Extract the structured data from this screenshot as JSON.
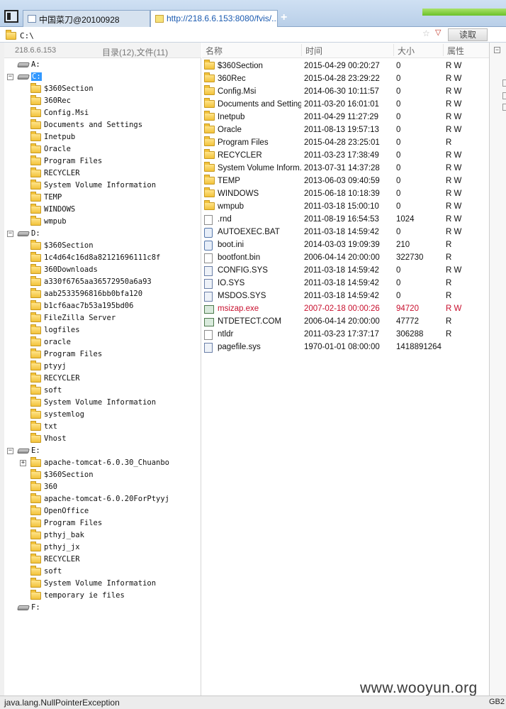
{
  "tabs": [
    {
      "label": "中国菜刀@20100928",
      "active": false
    },
    {
      "label": "http://218.6.6.153:8080/fvis/...",
      "active": true
    }
  ],
  "new_tab_label": "+",
  "address": {
    "value": "C:\\",
    "read_button": "读取"
  },
  "left_header": {
    "ip": "218.6.6.153",
    "counts": "目录(12),文件(11)"
  },
  "tree": [
    {
      "label": "A:",
      "type": "drive",
      "level": 0,
      "expander": ""
    },
    {
      "label": "C:",
      "type": "drive",
      "level": 0,
      "expander": "−",
      "selected": true
    },
    {
      "label": "$360Section",
      "type": "folder",
      "level": 1
    },
    {
      "label": "360Rec",
      "type": "folder",
      "level": 1
    },
    {
      "label": "Config.Msi",
      "type": "folder",
      "level": 1
    },
    {
      "label": "Documents and Settings",
      "type": "folder",
      "level": 1
    },
    {
      "label": "Inetpub",
      "type": "folder",
      "level": 1
    },
    {
      "label": "Oracle",
      "type": "folder",
      "level": 1
    },
    {
      "label": "Program Files",
      "type": "folder",
      "level": 1
    },
    {
      "label": "RECYCLER",
      "type": "folder",
      "level": 1
    },
    {
      "label": "System Volume Information",
      "type": "folder",
      "level": 1
    },
    {
      "label": "TEMP",
      "type": "folder",
      "level": 1
    },
    {
      "label": "WINDOWS",
      "type": "folder",
      "level": 1
    },
    {
      "label": "wmpub",
      "type": "folder",
      "level": 1
    },
    {
      "label": "D:",
      "type": "drive",
      "level": 0,
      "expander": "−"
    },
    {
      "label": "$360Section",
      "type": "folder",
      "level": 1
    },
    {
      "label": "1c4d64c16d8a82121696111c8f",
      "type": "folder",
      "level": 1
    },
    {
      "label": "360Downloads",
      "type": "folder",
      "level": 1
    },
    {
      "label": "a330f6765aa36572950a6a93",
      "type": "folder",
      "level": 1
    },
    {
      "label": "aab2533596816bb0bfa120",
      "type": "folder",
      "level": 1
    },
    {
      "label": "b1cf6aac7b53a195bd06",
      "type": "folder",
      "level": 1
    },
    {
      "label": "FileZilla Server",
      "type": "folder",
      "level": 1
    },
    {
      "label": "logfiles",
      "type": "folder",
      "level": 1
    },
    {
      "label": "oracle",
      "type": "folder",
      "level": 1
    },
    {
      "label": "Program Files",
      "type": "folder",
      "level": 1
    },
    {
      "label": "ptyyj",
      "type": "folder",
      "level": 1
    },
    {
      "label": "RECYCLER",
      "type": "folder",
      "level": 1
    },
    {
      "label": "soft",
      "type": "folder",
      "level": 1
    },
    {
      "label": "System Volume Information",
      "type": "folder",
      "level": 1
    },
    {
      "label": "systemlog",
      "type": "folder",
      "level": 1
    },
    {
      "label": "txt",
      "type": "folder",
      "level": 1
    },
    {
      "label": "Vhost",
      "type": "folder",
      "level": 1
    },
    {
      "label": "E:",
      "type": "drive",
      "level": 0,
      "expander": "−"
    },
    {
      "label": "apache-tomcat-6.0.30_Chuanbo",
      "type": "folder",
      "level": 1,
      "expander": "+"
    },
    {
      "label": "$360Section",
      "type": "folder",
      "level": 1
    },
    {
      "label": "360",
      "type": "folder",
      "level": 1
    },
    {
      "label": "apache-tomcat-6.0.20ForPtyyj",
      "type": "folder",
      "level": 1
    },
    {
      "label": "OpenOffice",
      "type": "folder",
      "level": 1
    },
    {
      "label": "Program Files",
      "type": "folder",
      "level": 1
    },
    {
      "label": "pthyj_bak",
      "type": "folder",
      "level": 1
    },
    {
      "label": "pthyj_jx",
      "type": "folder",
      "level": 1
    },
    {
      "label": "RECYCLER",
      "type": "folder",
      "level": 1
    },
    {
      "label": "soft",
      "type": "folder",
      "level": 1
    },
    {
      "label": "System Volume Information",
      "type": "folder",
      "level": 1
    },
    {
      "label": "temporary ie files",
      "type": "folder",
      "level": 1
    },
    {
      "label": "F:",
      "type": "drive",
      "level": 0,
      "expander": ""
    }
  ],
  "file_columns": [
    "名称",
    "时间",
    "大小",
    "属性"
  ],
  "files": [
    {
      "name": "$360Section",
      "time": "2015-04-29 00:20:27",
      "size": "0",
      "attr": "R W",
      "icon": "folder"
    },
    {
      "name": "360Rec",
      "time": "2015-04-28 23:29:22",
      "size": "0",
      "attr": "R W",
      "icon": "folder"
    },
    {
      "name": "Config.Msi",
      "time": "2014-06-30 10:11:57",
      "size": "0",
      "attr": "R W",
      "icon": "folder"
    },
    {
      "name": "Documents and Settings",
      "time": "2011-03-20 16:01:01",
      "size": "0",
      "attr": "R W",
      "icon": "folder"
    },
    {
      "name": "Inetpub",
      "time": "2011-04-29 11:27:29",
      "size": "0",
      "attr": "R W",
      "icon": "folder"
    },
    {
      "name": "Oracle",
      "time": "2011-08-13 19:57:13",
      "size": "0",
      "attr": "R W",
      "icon": "folder"
    },
    {
      "name": "Program Files",
      "time": "2015-04-28 23:25:01",
      "size": "0",
      "attr": "R",
      "icon": "folder"
    },
    {
      "name": "RECYCLER",
      "time": "2011-03-23 17:38:49",
      "size": "0",
      "attr": "R W",
      "icon": "folder"
    },
    {
      "name": "System Volume Inform...",
      "time": "2013-07-31 14:37:28",
      "size": "0",
      "attr": "R W",
      "icon": "folder"
    },
    {
      "name": "TEMP",
      "time": "2013-06-03 09:40:59",
      "size": "0",
      "attr": "R W",
      "icon": "folder"
    },
    {
      "name": "WINDOWS",
      "time": "2015-06-18 10:18:39",
      "size": "0",
      "attr": "R W",
      "icon": "folder"
    },
    {
      "name": "wmpub",
      "time": "2011-03-18 15:00:10",
      "size": "0",
      "attr": "R W",
      "icon": "folder"
    },
    {
      "name": ".rnd",
      "time": "2011-08-19 16:54:53",
      "size": "1024",
      "attr": "R W",
      "icon": "file"
    },
    {
      "name": "AUTOEXEC.BAT",
      "time": "2011-03-18 14:59:42",
      "size": "0",
      "attr": "R W",
      "icon": "bat"
    },
    {
      "name": "boot.ini",
      "time": "2014-03-03 19:09:39",
      "size": "210",
      "attr": "R",
      "icon": "bat"
    },
    {
      "name": "bootfont.bin",
      "time": "2006-04-14 20:00:00",
      "size": "322730",
      "attr": "R",
      "icon": "file"
    },
    {
      "name": "CONFIG.SYS",
      "time": "2011-03-18 14:59:42",
      "size": "0",
      "attr": "R W",
      "icon": "sys"
    },
    {
      "name": "IO.SYS",
      "time": "2011-03-18 14:59:42",
      "size": "0",
      "attr": "R",
      "icon": "sys"
    },
    {
      "name": "MSDOS.SYS",
      "time": "2011-03-18 14:59:42",
      "size": "0",
      "attr": "R",
      "icon": "sys"
    },
    {
      "name": "msizap.exe",
      "time": "2007-02-18 00:00:26",
      "size": "94720",
      "attr": "R W",
      "icon": "exe",
      "highlight": true
    },
    {
      "name": "NTDETECT.COM",
      "time": "2006-04-14 20:00:00",
      "size": "47772",
      "attr": "R",
      "icon": "exe"
    },
    {
      "name": "ntldr",
      "time": "2011-03-23 17:37:17",
      "size": "306288",
      "attr": "R",
      "icon": "file"
    },
    {
      "name": "pagefile.sys",
      "time": "1970-01-01 08:00:00",
      "size": "1418891264",
      "attr": "",
      "icon": "sys"
    }
  ],
  "status": {
    "message": "java.lang.NullPointerException",
    "encoding": "GB2"
  },
  "watermark": "www.wooyun.org"
}
